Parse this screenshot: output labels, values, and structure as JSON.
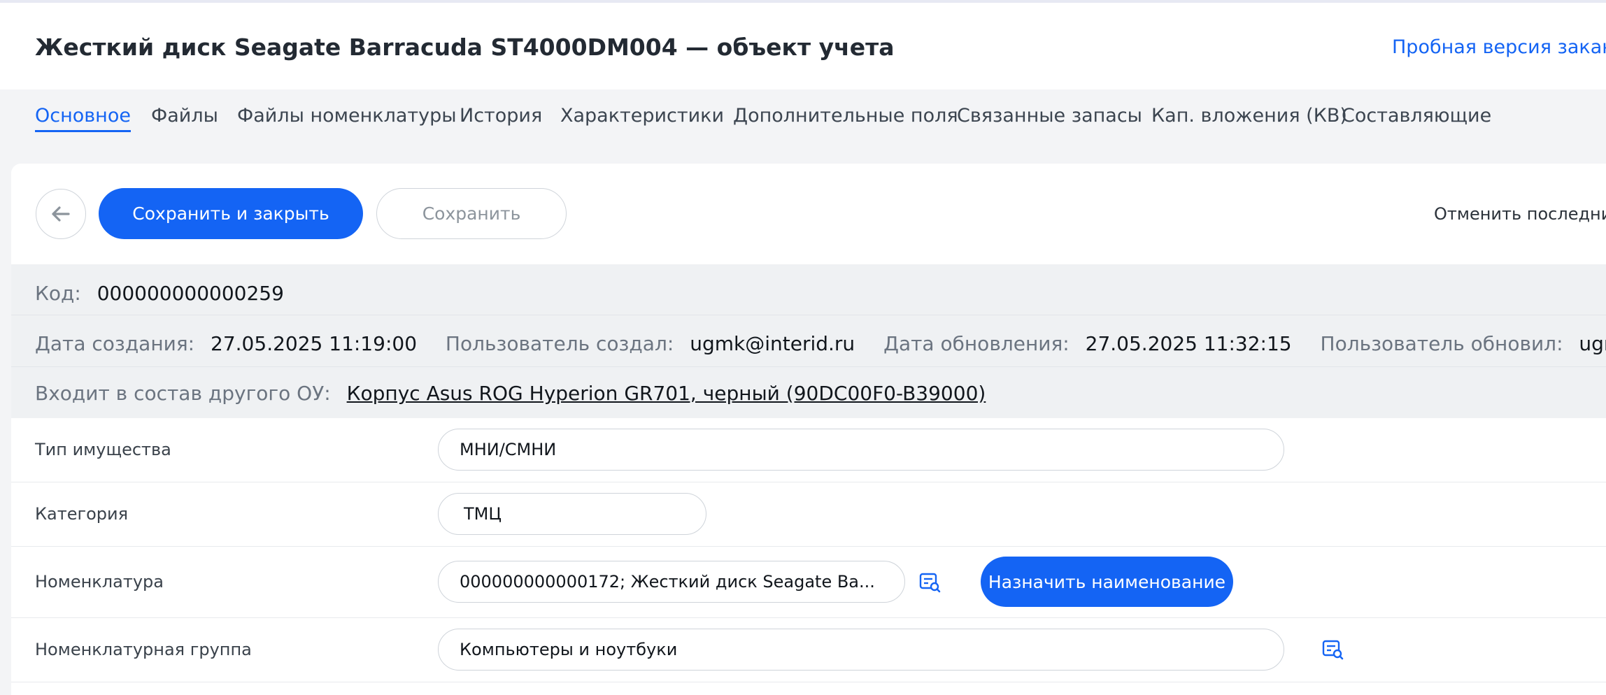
{
  "header": {
    "title": "Жесткий диск Seagate Barracuda ST4000DM004 — объект учета",
    "trial_link": "Пробная версия закан"
  },
  "tabs": [
    {
      "label": "Основное",
      "active": true
    },
    {
      "label": "Файлы"
    },
    {
      "label": "Файлы номенклатуры"
    },
    {
      "label": "История"
    },
    {
      "label": "Характеристики"
    },
    {
      "label": "Дополнительные поля"
    },
    {
      "label": "Связанные запасы"
    },
    {
      "label": "Кап. вложения (КВ)"
    },
    {
      "label": "Составляющие"
    }
  ],
  "toolbar": {
    "save_close_label": "Сохранить и закрыть",
    "save_label": "Сохранить",
    "cancel_label": "Отменить последние"
  },
  "info": {
    "code_label": "Код:",
    "code_value": "000000000000259",
    "created_date_label": "Дата создания:",
    "created_date_value": "27.05.2025 11:19:00",
    "created_by_label": "Пользователь создал:",
    "created_by_value": "ugmk@interid.ru",
    "updated_date_label": "Дата обновления:",
    "updated_date_value": "27.05.2025 11:32:15",
    "updated_by_label": "Пользователь обновил:",
    "updated_by_value": "ugmk@interid.ru",
    "parent_label": "Входит в состав другого ОУ:",
    "parent_value": "Корпус Asus ROG Hyperion GR701, черный (90DC00F0-B39000)"
  },
  "form": {
    "property_type_label": "Тип имущества",
    "property_type_value": "МНИ/СМНИ",
    "category_label": "Категория",
    "category_value": "ТМЦ",
    "nomenclature_label": "Номенклатура",
    "nomenclature_value": "000000000000172; Жесткий диск Seagate Ba...",
    "assign_name_label": "Назначить наименование",
    "nomenclature_group_label": "Номенклатурная группа",
    "nomenclature_group_value": "Компьютеры и ноутбуки"
  },
  "colors": {
    "accent": "#1464f4",
    "background": "#f3f4f6",
    "info_background": "#eff1f3"
  }
}
